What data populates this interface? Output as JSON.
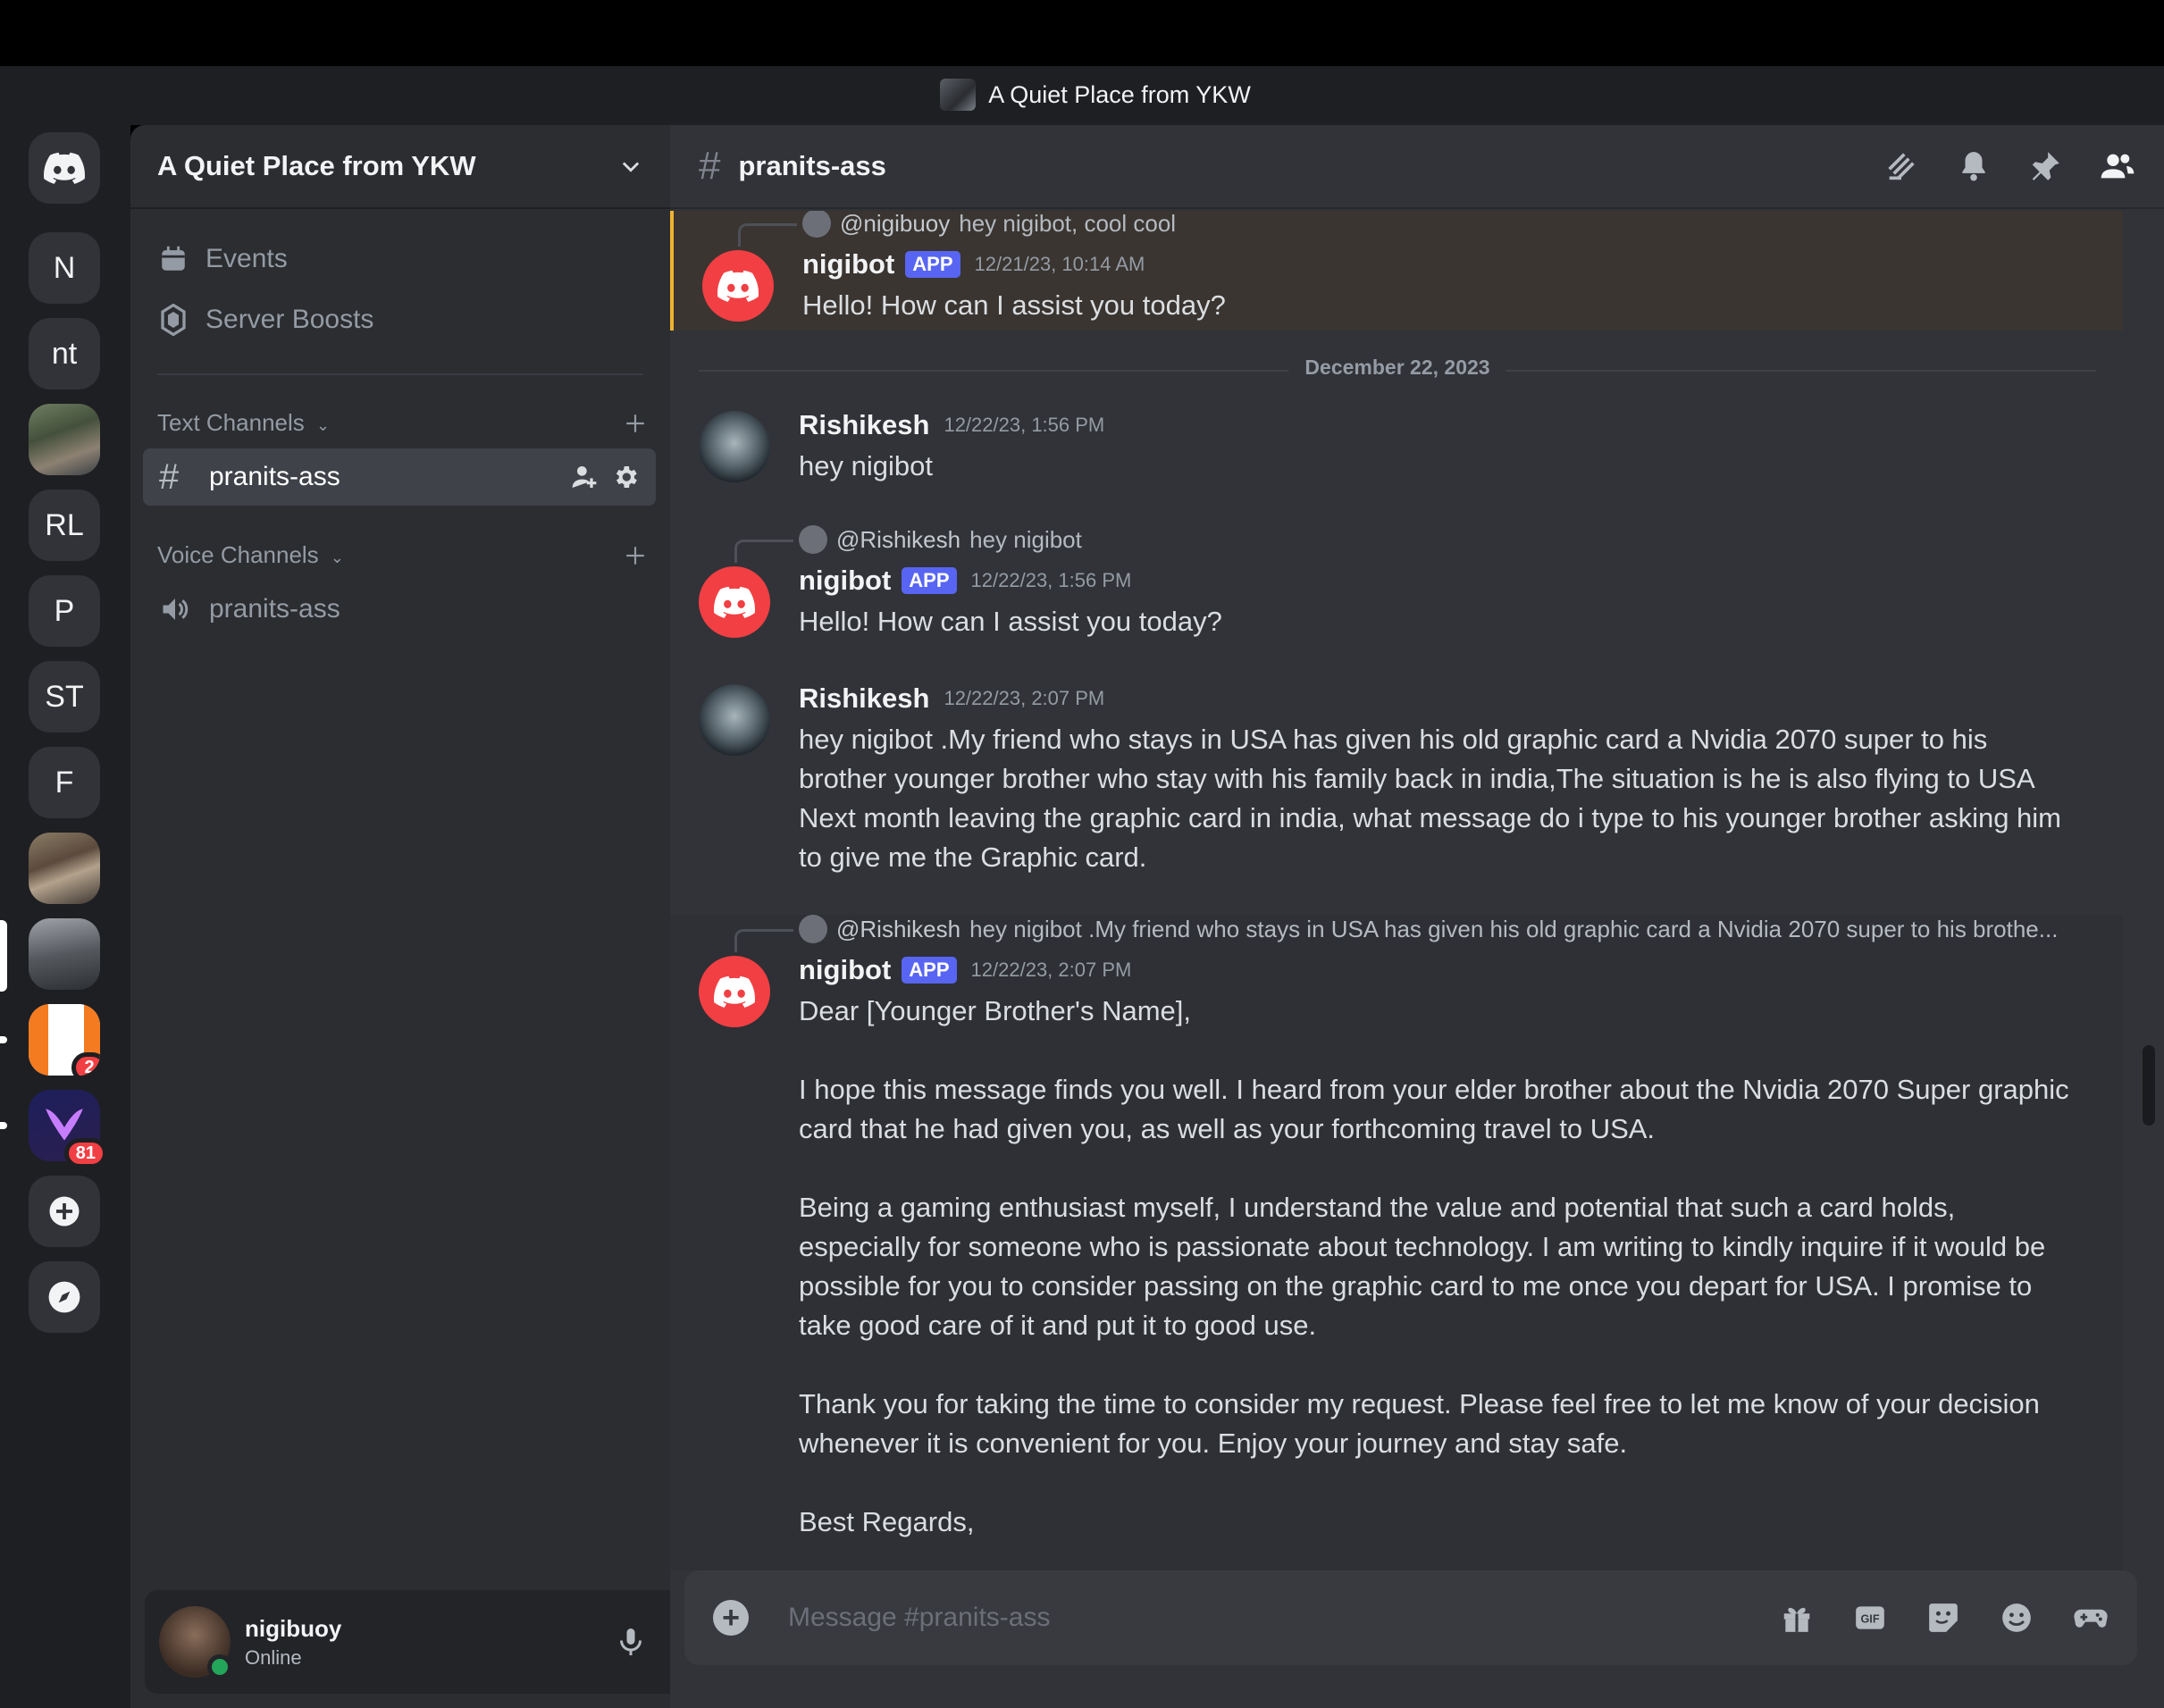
{
  "window": {
    "title": "A Quiet Place from YKW"
  },
  "rail": {
    "servers": [
      {
        "label": "N"
      },
      {
        "label": "nt"
      },
      {
        "label": "RL"
      },
      {
        "label": "P"
      },
      {
        "label": "ST"
      },
      {
        "label": "F"
      }
    ],
    "badges": {
      "first": "2",
      "second": "81"
    }
  },
  "sidebar": {
    "guild_name": "A Quiet Place from YKW",
    "events_label": "Events",
    "boosts_label": "Server Boosts",
    "text_category": "Text Channels",
    "text_channel": "pranits-ass",
    "voice_category": "Voice Channels",
    "voice_channel": "pranits-ass"
  },
  "user": {
    "name": "nigibuoy",
    "status": "Online"
  },
  "channel": {
    "name": "pranits-ass"
  },
  "messages": [
    {
      "reply_name": "@nigibuoy",
      "reply_text": "hey nigibot, cool cool",
      "author": "nigibot",
      "tag": "APP",
      "time": "12/21/23, 10:14 AM",
      "text": "Hello! How can I assist you today?"
    },
    {
      "date_divider": "December 22, 2023"
    },
    {
      "author": "Rishikesh",
      "time": "12/22/23, 1:56 PM",
      "text": "hey nigibot"
    },
    {
      "reply_name": "@Rishikesh",
      "reply_text": "hey nigibot",
      "author": "nigibot",
      "tag": "APP",
      "time": "12/22/23, 1:56 PM",
      "text": "Hello! How can I assist you today?"
    },
    {
      "author": "Rishikesh",
      "time": "12/22/23, 2:07 PM",
      "text": "hey nigibot .My friend who stays in USA has given his old graphic card a Nvidia 2070 super to his brother younger brother who stay with his family back in india,The situation is he is also flying to USA Next month leaving the graphic card in india, what message do i type to his younger brother asking him to give me the Graphic card."
    },
    {
      "reply_name": "@Rishikesh",
      "reply_text": "hey nigibot .My friend who stays in USA has given his old graphic card a Nvidia 2070 super to his brothe...",
      "author": "nigibot",
      "tag": "APP",
      "time": "12/22/23, 2:07 PM",
      "paragraphs": [
        "Dear [Younger Brother's Name],",
        "I hope this message finds you well. I heard from your elder brother about the Nvidia 2070 Super graphic card that he had given you, as well as your forthcoming travel to USA.",
        "Being a gaming enthusiast myself, I understand the value and potential that such a card holds, especially for someone who is passionate about technology. I am writing to kindly inquire if it would be possible for you to consider passing on the graphic card to me once you depart for USA. I promise to take good care of it and put it to good use.",
        "Thank you for taking the time to consider my request. Please feel free to let me know of your decision whenever it is convenient for you. Enjoy your journey and stay safe.",
        "Best Regards,"
      ]
    }
  ],
  "composer": {
    "placeholder": "Message #pranits-ass"
  },
  "icons": {
    "rail": [
      "discord-icon",
      "add-server-icon",
      "discover-icon"
    ],
    "header": [
      "threads-icon",
      "bell-icon",
      "pin-icon",
      "members-icon"
    ],
    "composer": [
      "gift-icon",
      "gif-icon",
      "sticker-icon",
      "emoji-icon",
      "activities-icon"
    ]
  },
  "colors": {
    "accent": "#5865f2",
    "bot_avatar": "#f23f43",
    "online": "#23a55a",
    "badge": "#f23f43",
    "mention_highlight": "#f0b232"
  }
}
